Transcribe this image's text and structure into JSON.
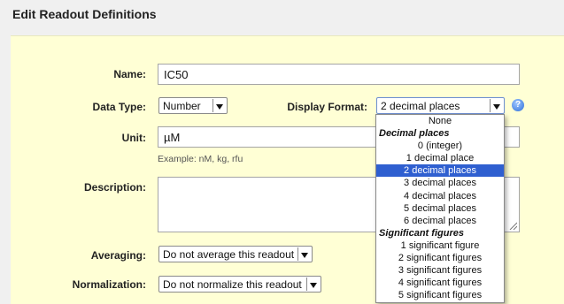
{
  "page": {
    "title": "Edit Readout Definitions"
  },
  "form": {
    "name": {
      "label": "Name:",
      "value": "IC50"
    },
    "data_type": {
      "label": "Data Type:",
      "value": "Number"
    },
    "display_format": {
      "label": "Display Format:",
      "value": "2 decimal places"
    },
    "unit": {
      "label": "Unit:",
      "value": "µM",
      "hint": "Example: nM, kg, rfu"
    },
    "description": {
      "label": "Description:",
      "value": ""
    },
    "averaging": {
      "label": "Averaging:",
      "value": "Do not average this readout"
    },
    "normalization": {
      "label": "Normalization:",
      "value": "Do not normalize this readout"
    }
  },
  "help_icon": {
    "glyph": "?"
  },
  "dropdown": {
    "none": "None",
    "group_decimal": "Decimal places",
    "decimal_options": [
      "0 (integer)",
      "1 decimal place",
      "2 decimal places",
      "3 decimal places",
      "4 decimal places",
      "5 decimal places",
      "6 decimal places"
    ],
    "selected": "2 decimal places",
    "group_sig": "Significant figures",
    "sig_options": [
      "1 significant figure",
      "2 significant figures",
      "3 significant figures",
      "4 significant figures",
      "5 significant figures"
    ]
  },
  "colors": {
    "panel": "#ffffd5",
    "selection": "#2f5fd0"
  }
}
